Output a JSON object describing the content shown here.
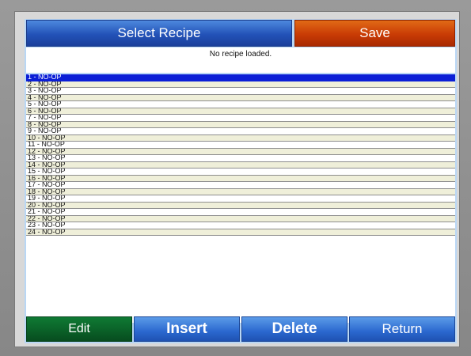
{
  "header": {
    "select_recipe_label": "Select Recipe",
    "save_label": "Save"
  },
  "status_text": "No recipe loaded.",
  "recipes": [
    "1 - NO-OP",
    "2 - NO-OP",
    "3 - NO-OP",
    "4 - NO-OP",
    "5 - NO-OP",
    "6 - NO-OP",
    "7 - NO-OP",
    "8 - NO-OP",
    "9 - NO-OP",
    "10 - NO-OP",
    "11 - NO-OP",
    "12 - NO-OP",
    "13 - NO-OP",
    "14 - NO-OP",
    "15 - NO-OP",
    "16 - NO-OP",
    "17 - NO-OP",
    "18 - NO-OP",
    "19 - NO-OP",
    "20 - NO-OP",
    "21 - NO-OP",
    "22 - NO-OP",
    "23 - NO-OP",
    "24 - NO-OP"
  ],
  "selected_index": 0,
  "footer": {
    "edit_label": "Edit",
    "insert_label": "Insert",
    "delete_label": "Delete",
    "return_label": "Return"
  },
  "colors": {
    "selected_row": "#0b1fd6",
    "select_button": "#2352b8",
    "save_button": "#c93b05",
    "edit_button": "#0a5f27",
    "action_buttons": "#2b68cf"
  }
}
